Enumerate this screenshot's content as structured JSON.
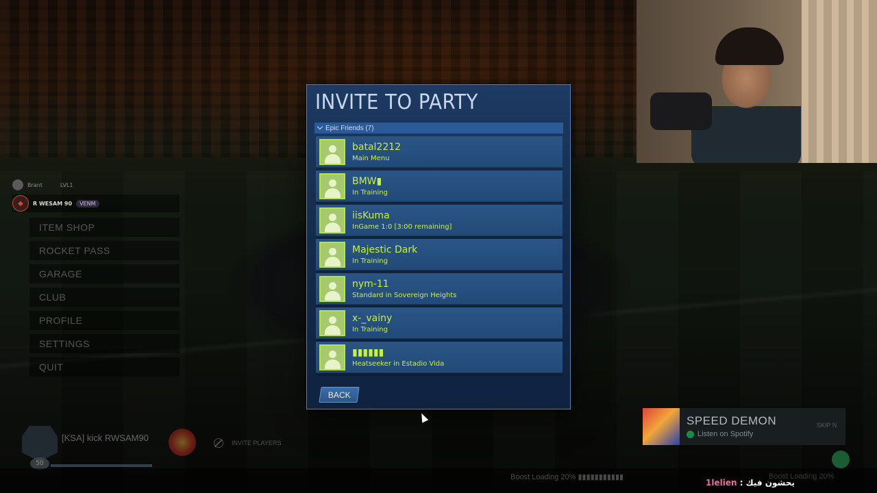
{
  "colors": {
    "accent_green": "#c7f23a",
    "modal_blue": "#1d3a63",
    "header_blue": "#2a5a98"
  },
  "modal": {
    "title": "INVITE TO PARTY",
    "group_label": "Epic Friends (7)",
    "friends": [
      {
        "name": "batal2212",
        "status": "Main Menu"
      },
      {
        "name": "BMW▮",
        "status": "In Training"
      },
      {
        "name": "iisKuma",
        "status": "InGame 1:0 [3:00 remaining]"
      },
      {
        "name": "Majestic Dark",
        "status": "In Training"
      },
      {
        "name": "nym-11",
        "status": "Standard in Sovereign Heights"
      },
      {
        "name": "x-_vainy",
        "status": "In Training"
      },
      {
        "name": "▮▮▮▮▮▮",
        "status": "Heatseeker in Estadio Vida"
      }
    ],
    "back_label": "BACK"
  },
  "left_panel": {
    "small_player": "Brant",
    "small_badge": "LVL1",
    "me_name": "R WESAM 90",
    "me_badge": "VENM",
    "menu": [
      "ITEM SHOP",
      "ROCKET PASS",
      "GARAGE",
      "CLUB",
      "PROFILE",
      "SETTINGS",
      "QUIT"
    ]
  },
  "player_card": {
    "name": "[KSA] kick RWSAM90",
    "level": "50"
  },
  "invite_players_label": "INVITE PLAYERS",
  "spotify": {
    "title": "SPEED DEMON",
    "subtitle": "Listen on Spotify",
    "skip": "SKIP N"
  },
  "bottom": {
    "boost1": "Boost Loading 20% ▮▮▮▮▮▮▮▮▮▮▮",
    "boost2": "Boost Loading 20%"
  },
  "chat": {
    "user": "1lelien",
    "separator": " : ",
    "message": "يحشون فيك"
  }
}
